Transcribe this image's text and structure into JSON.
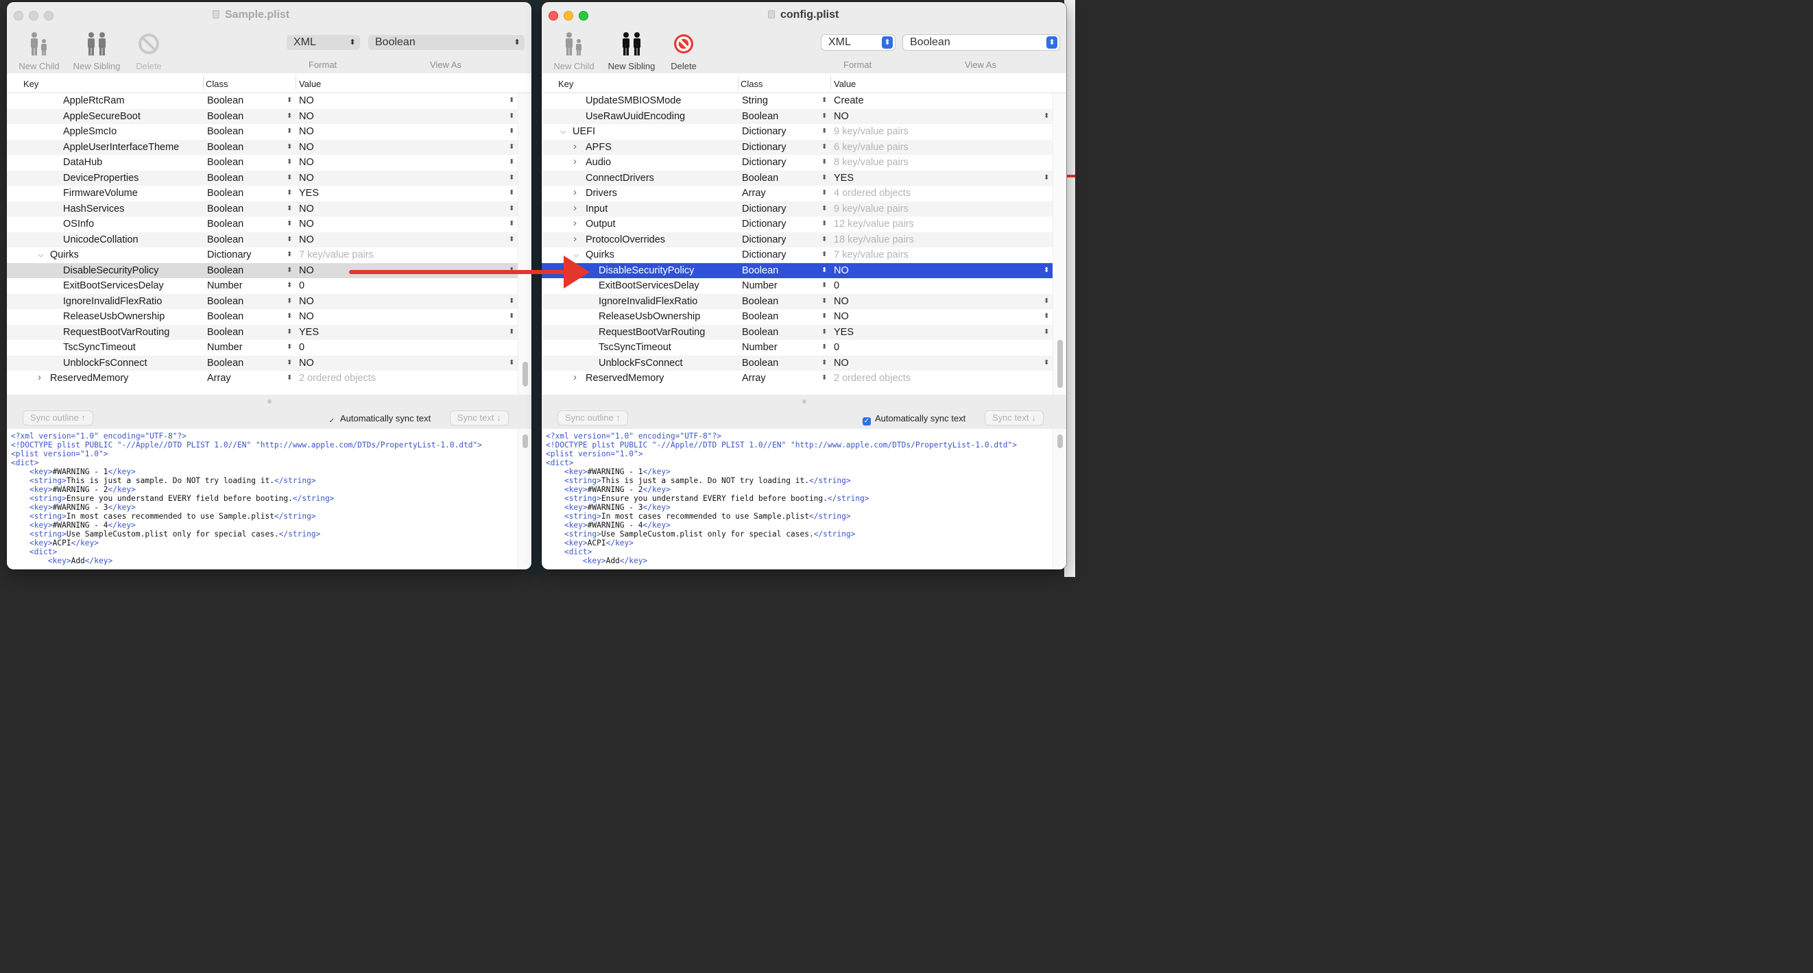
{
  "left_window": {
    "title": "Sample.plist",
    "toolbar": {
      "new_child": "New Child",
      "new_sibling": "New Sibling",
      "delete": "Delete",
      "format_value": "XML",
      "view_as_value": "Boolean",
      "format_label": "Format",
      "view_as_label": "View As"
    },
    "columns": {
      "key": "Key",
      "class": "Class",
      "value": "Value"
    },
    "rows": [
      {
        "key": "AppleRtcRam",
        "class": "Boolean",
        "value": "NO"
      },
      {
        "key": "AppleSecureBoot",
        "class": "Boolean",
        "value": "NO"
      },
      {
        "key": "AppleSmcIo",
        "class": "Boolean",
        "value": "NO"
      },
      {
        "key": "AppleUserInterfaceTheme",
        "class": "Boolean",
        "value": "NO"
      },
      {
        "key": "DataHub",
        "class": "Boolean",
        "value": "NO"
      },
      {
        "key": "DeviceProperties",
        "class": "Boolean",
        "value": "NO"
      },
      {
        "key": "FirmwareVolume",
        "class": "Boolean",
        "value": "YES"
      },
      {
        "key": "HashServices",
        "class": "Boolean",
        "value": "NO"
      },
      {
        "key": "OSInfo",
        "class": "Boolean",
        "value": "NO"
      },
      {
        "key": "UnicodeCollation",
        "class": "Boolean",
        "value": "NO"
      },
      {
        "key": "Quirks",
        "class": "Dictionary",
        "value": "7 key/value pairs"
      },
      {
        "key": "DisableSecurityPolicy",
        "class": "Boolean",
        "value": "NO"
      },
      {
        "key": "ExitBootServicesDelay",
        "class": "Number",
        "value": "0"
      },
      {
        "key": "IgnoreInvalidFlexRatio",
        "class": "Boolean",
        "value": "NO"
      },
      {
        "key": "ReleaseUsbOwnership",
        "class": "Boolean",
        "value": "NO"
      },
      {
        "key": "RequestBootVarRouting",
        "class": "Boolean",
        "value": "YES"
      },
      {
        "key": "TscSyncTimeout",
        "class": "Number",
        "value": "0"
      },
      {
        "key": "UnblockFsConnect",
        "class": "Boolean",
        "value": "NO"
      },
      {
        "key": "ReservedMemory",
        "class": "Array",
        "value": "2 ordered objects"
      }
    ],
    "sync": {
      "outline": "Sync outline ↑",
      "auto": "Automatically sync text",
      "text": "Sync text ↓"
    }
  },
  "right_window": {
    "title": "config.plist",
    "toolbar": {
      "new_child": "New Child",
      "new_sibling": "New Sibling",
      "delete": "Delete",
      "format_value": "XML",
      "view_as_value": "Boolean",
      "format_label": "Format",
      "view_as_label": "View As"
    },
    "columns": {
      "key": "Key",
      "class": "Class",
      "value": "Value"
    },
    "rows": [
      {
        "key": "UpdateSMBIOSMode",
        "class": "String",
        "value": "Create"
      },
      {
        "key": "UseRawUuidEncoding",
        "class": "Boolean",
        "value": "NO"
      },
      {
        "key": "UEFI",
        "class": "Dictionary",
        "value": "9 key/value pairs"
      },
      {
        "key": "APFS",
        "class": "Dictionary",
        "value": "6 key/value pairs"
      },
      {
        "key": "Audio",
        "class": "Dictionary",
        "value": "8 key/value pairs"
      },
      {
        "key": "ConnectDrivers",
        "class": "Boolean",
        "value": "YES"
      },
      {
        "key": "Drivers",
        "class": "Array",
        "value": "4 ordered objects"
      },
      {
        "key": "Input",
        "class": "Dictionary",
        "value": "9 key/value pairs"
      },
      {
        "key": "Output",
        "class": "Dictionary",
        "value": "12 key/value pairs"
      },
      {
        "key": "ProtocolOverrides",
        "class": "Dictionary",
        "value": "18 key/value pairs"
      },
      {
        "key": "Quirks",
        "class": "Dictionary",
        "value": "7 key/value pairs"
      },
      {
        "key": "DisableSecurityPolicy",
        "class": "Boolean",
        "value": "NO"
      },
      {
        "key": "ExitBootServicesDelay",
        "class": "Number",
        "value": "0"
      },
      {
        "key": "IgnoreInvalidFlexRatio",
        "class": "Boolean",
        "value": "NO"
      },
      {
        "key": "ReleaseUsbOwnership",
        "class": "Boolean",
        "value": "NO"
      },
      {
        "key": "RequestBootVarRouting",
        "class": "Boolean",
        "value": "YES"
      },
      {
        "key": "TscSyncTimeout",
        "class": "Number",
        "value": "0"
      },
      {
        "key": "UnblockFsConnect",
        "class": "Boolean",
        "value": "NO"
      },
      {
        "key": "ReservedMemory",
        "class": "Array",
        "value": "2 ordered objects"
      }
    ],
    "sync": {
      "outline": "Sync outline ↑",
      "auto": "Automatically sync text",
      "text": "Sync text ↓"
    }
  },
  "xml_lines": [
    "<?xml version=\"1.0\" encoding=\"UTF-8\"?>",
    "<!DOCTYPE plist PUBLIC \"-//Apple//DTD PLIST 1.0//EN\" \"http://www.apple.com/DTDs/PropertyList-1.0.dtd\">",
    "<plist version=\"1.0\">",
    "<dict>",
    "    <key>#WARNING - 1</key>",
    "    <string>This is just a sample. Do NOT try loading it.</string>",
    "    <key>#WARNING - 2</key>",
    "    <string>Ensure you understand EVERY field before booting.</string>",
    "    <key>#WARNING - 3</key>",
    "    <string>In most cases recommended to use Sample.plist</string>",
    "    <key>#WARNING - 4</key>",
    "    <string>Use SampleCustom.plist only for special cases.</string>",
    "    <key>ACPI</key>",
    "    <dict>",
    "        <key>Add</key>"
  ],
  "colors": {
    "selection_blue": "#2f50d9",
    "arrow_red": "#e4372c",
    "xml_tag": "#3a55c8"
  }
}
